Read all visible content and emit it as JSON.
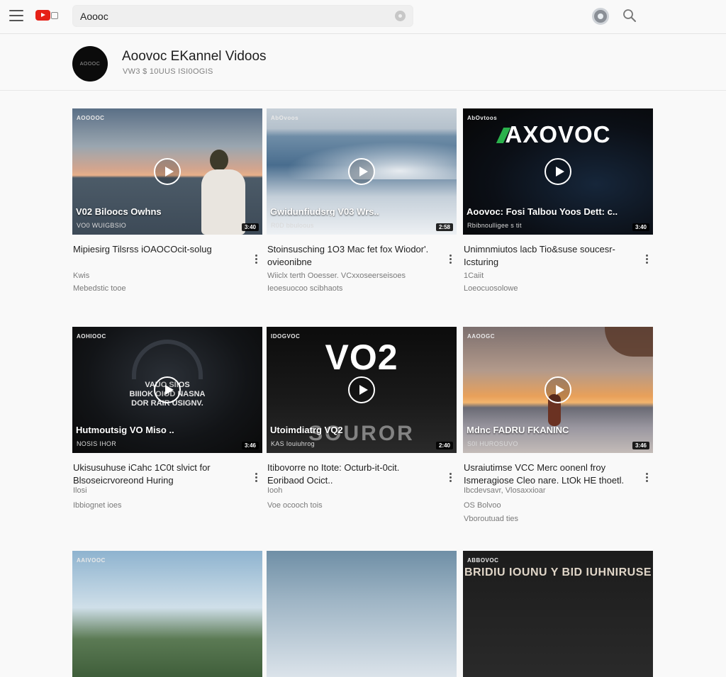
{
  "search": {
    "value": "Aoooc"
  },
  "channel": {
    "title": "Aoovoc EKannel Vidoos",
    "subtitle": "VW3 $ 10UUS ISI0OGIS",
    "avatar_text": "AOOOC"
  },
  "videos": [
    {
      "thumb_tag": "AOOOOC",
      "caption": "V02 Biloocs Owhns",
      "thumb_sub": "VO0 WUIGBSIO",
      "duration": "3:40",
      "title": "Mipiesirg Tilsrss iOAOCOcit-solug",
      "meta1": "Kwis",
      "meta2": "Mebedstic tooe"
    },
    {
      "thumb_tag": "AbOvoos",
      "caption": "Gwidunfiudsrg V03 Wrs..",
      "thumb_sub": "R0D bbuloous",
      "duration": "2:58",
      "title": "Stoinsusching 1O3 Mac fet fox Wiodor'. ovieonibne",
      "meta1": "Wiiclx terth Ooesser. VCxxoseerseisoes",
      "meta2": "Ieoesuocoo scibhaots"
    },
    {
      "thumb_tag": "AbOvtoos",
      "caption": "Aoovoc: Fosi Talbou Yoos Dett: c..",
      "thumb_sub": "Rbibnoulligee s tit",
      "duration": "3:40",
      "big_text": "AXOVOC",
      "title": "Unimnmiutos lacb Tio&suse soucesr-Icsturing",
      "meta1": "1Caiit",
      "meta2": "Loeocuosolowe"
    },
    {
      "thumb_tag": "AOHIOOC",
      "caption": "Hutmoutsig VO Miso ..",
      "thumb_sub": "NOSIS IHOR",
      "duration": "3:46",
      "big_text": "VAUO SIIOS\nBIIIOK OIOD NASNA\nDOR RAIR USIGNV.",
      "title": "Ukisusuhuse iCahc 1C0t slvict for Blsoseicrvoreond Huring",
      "meta1": "Ilosi",
      "meta2": "Ibbiognet ioes"
    },
    {
      "thumb_tag": "IDOGVOC",
      "caption": "Utoimdiatrg VQ2",
      "thumb_sub": "KAS Iouiuhrog",
      "duration": "2:40",
      "big_text": "VO2",
      "overlay_text": "SOUROR",
      "title": "Itibovorre no Itote: Octurb-it-0cit. Eoribaod Ocict..",
      "meta1": "Iooh",
      "meta2": "Voe ocooch tois"
    },
    {
      "thumb_tag": "AAOOGC",
      "caption": "Mdnc FADRU FKANINC",
      "thumb_sub": "S0I HUROSUVO",
      "duration": "3:46",
      "title": "Usraiutimse VCC Merc oonenl froy Ismeragiose Cleo nare. LtOk HE thoetl.",
      "meta1": "Ibcdevsavr, Vlosaxxioar",
      "meta2": "OS Bolvoo",
      "meta3": "Vboroutuad ties"
    },
    {
      "thumb_tag": "AAIVOOC"
    },
    {
      "thumb_tag": ""
    },
    {
      "thumb_tag": "ABBOVOC",
      "big_text": "BRIDIU IOUNU Y BID IUHNIRUSE"
    }
  ]
}
